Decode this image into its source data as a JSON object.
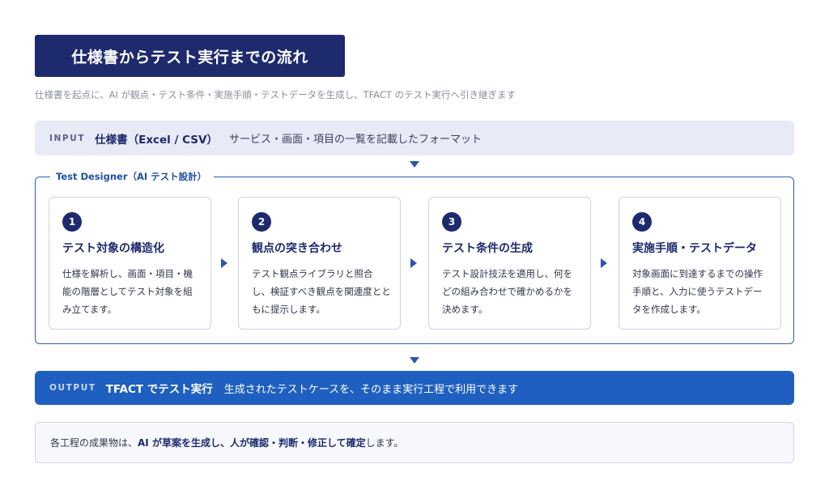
{
  "title": "仕様書からテスト実行までの流れ",
  "subtitle": "仕様書を起点に、AI が観点・テスト条件・実施手順・テストデータを生成し、TFACT のテスト実行へ引き継ぎます",
  "input": {
    "tag": "INPUT",
    "heading": "仕様書（Excel / CSV）",
    "description": "サービス・画面・項目の一覧を記載したフォーマット"
  },
  "designer_label": "Test Designer（AI テスト設計）",
  "steps": [
    {
      "number": "1",
      "title": "テスト対象の構造化",
      "description": "仕様を解析し、画面・項目・機能の階層としてテスト対象を組み立てます。"
    },
    {
      "number": "2",
      "title": "観点の突き合わせ",
      "description": "テスト観点ライブラリと照合し、検証すべき観点を関連度とともに提示します。"
    },
    {
      "number": "3",
      "title": "テスト条件の生成",
      "description": "テスト設計技法を適用し、何をどの組み合わせで確かめるかを決めます。"
    },
    {
      "number": "4",
      "title": "実施手順・テストデータ",
      "description": "対象画面に到達するまでの操作手順と、入力に使うテストデータを作成します。"
    }
  ],
  "output": {
    "tag": "OUTPUT",
    "heading": "TFACT でテスト実行",
    "description": "生成されたテストケースを、そのまま実行工程で利用できます"
  },
  "note": {
    "prefix": "各工程の成果物は、",
    "strong": "AI が草案を生成し、人が確認・判断・修正して確定",
    "suffix": "します。"
  },
  "colors": {
    "navy": "#1d2a6e",
    "accent_blue": "#1e5fbf",
    "input_bg": "#e8eaf5"
  }
}
